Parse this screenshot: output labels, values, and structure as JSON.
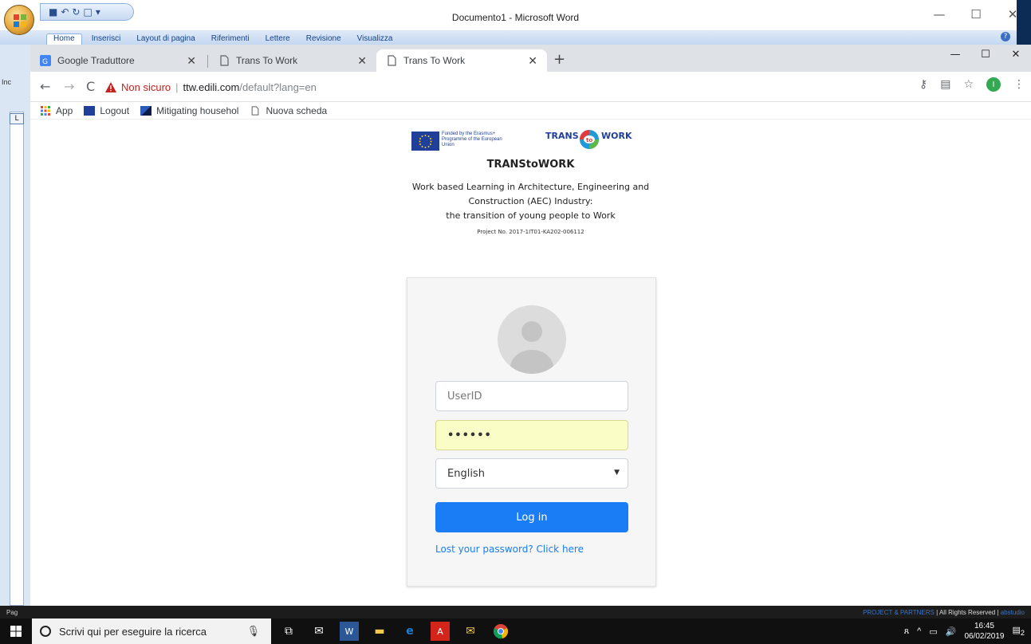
{
  "word": {
    "title": "Documento1 - Microsoft Word",
    "tabs": [
      "Home",
      "Inserisci",
      "Layout di pagina",
      "Riferimenti",
      "Lettere",
      "Revisione",
      "Visualizza"
    ],
    "side_labels": [
      "Inc",
      "Pag"
    ]
  },
  "chrome": {
    "tabs": [
      {
        "title": "Google Traduttore",
        "icon": "google-translate-icon"
      },
      {
        "title": "Trans To Work",
        "icon": "page-icon"
      },
      {
        "title": "Trans To Work",
        "icon": "page-icon",
        "active": true
      }
    ],
    "address": {
      "security": "Non sicuro",
      "host": "ttw.edili.com",
      "path": "/default?lang=en"
    },
    "bookmarks": [
      {
        "label": "App",
        "icon": "apps-grid-icon"
      },
      {
        "label": "Logout",
        "icon": "site-icon"
      },
      {
        "label": "Mitigating househol",
        "icon": "site-icon"
      },
      {
        "label": "Nuova scheda",
        "icon": "page-icon"
      }
    ],
    "profile_initial": "I"
  },
  "page": {
    "eu_text": "Funded by the Erasmus+ Programme of the European Union",
    "logo_text": {
      "trans": "TRANS",
      "to": "to",
      "work": "WORK"
    },
    "title": "TRANStoWORK",
    "subtitle_lines": [
      "Work based Learning in Architecture, Engineering and",
      "Construction (AEC) Industry:",
      "the transition of young people to Work"
    ],
    "project_no": "Project No. 2017-1IT01-KA202-006112",
    "login": {
      "userid_placeholder": "UserID",
      "password_value": "••••••",
      "language": "English",
      "button": "Log in",
      "lost_password": "Lost your password? Click here"
    }
  },
  "footer": {
    "project_partners": "PROJECT & PARTNERS",
    "rights": "| All Rights Reserved |",
    "studio": "abstudio"
  },
  "taskbar": {
    "search_placeholder": "Scrivi qui per eseguire la ricerca",
    "time": "16:45",
    "date": "06/02/2019",
    "notifications": "2"
  },
  "colors": {
    "accent": "#1a7df5",
    "not_secure": "#c5221f",
    "autofill": "#fafdc6"
  }
}
